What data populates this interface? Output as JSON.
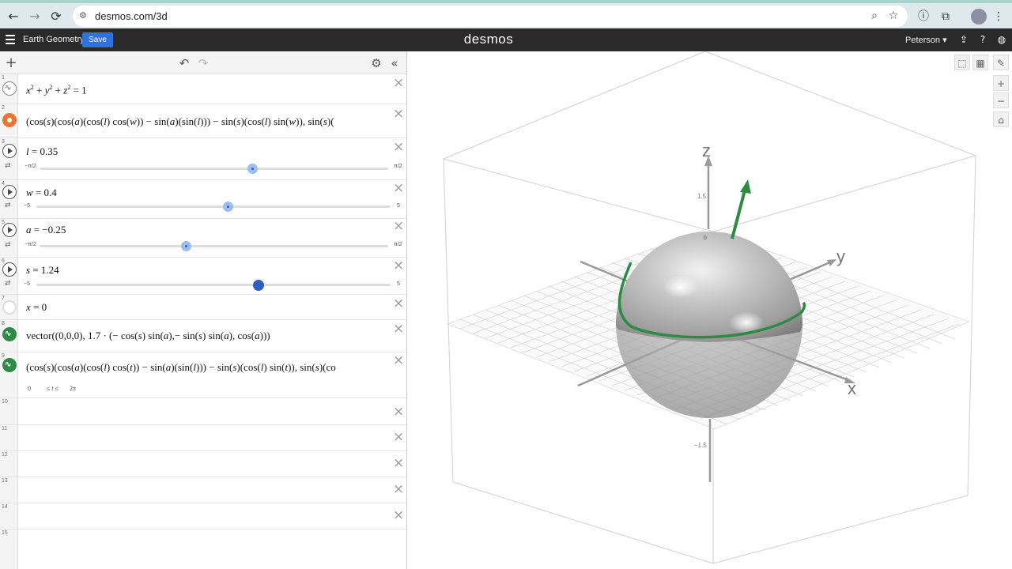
{
  "browser": {
    "url": "desmos.com/3d",
    "back_icon": "←",
    "forward_icon": "→",
    "reload_icon": "⟳"
  },
  "header": {
    "graph_title": "Earth Geometry",
    "save_label": "Save",
    "logo": "desmos",
    "user": "Peterson ▾"
  },
  "expressions": [
    {
      "num": "1"
    },
    {
      "num": "2"
    },
    {
      "num": "3",
      "slider_min": "−π/2",
      "slider_max": "π/2",
      "value": 0.35
    },
    {
      "num": "4",
      "slider_min": "−5",
      "slider_max": "5",
      "value": 0.4
    },
    {
      "num": "5",
      "slider_min": "−π/2",
      "slider_max": "π/2",
      "value": -0.25
    },
    {
      "num": "6",
      "slider_min": "−5",
      "slider_max": "5",
      "value": 1.24
    },
    {
      "num": "7"
    },
    {
      "num": "8"
    },
    {
      "num": "9",
      "domain_min": "0",
      "domain_mid": "≤ t ≤",
      "domain_max": "2π"
    },
    {
      "num": "10"
    },
    {
      "num": "11"
    },
    {
      "num": "12"
    },
    {
      "num": "13"
    },
    {
      "num": "14"
    },
    {
      "num": "15"
    }
  ],
  "graph": {
    "axis_x": "x",
    "axis_y": "y",
    "axis_z": "z",
    "tick_top": "1.5",
    "tick_bottom": "−1.5",
    "tick_origin": "0"
  },
  "colors": {
    "curve_green": "#2d8b45",
    "slider_blue": "#2f5fc0",
    "accent_orange": "#e8762d"
  }
}
